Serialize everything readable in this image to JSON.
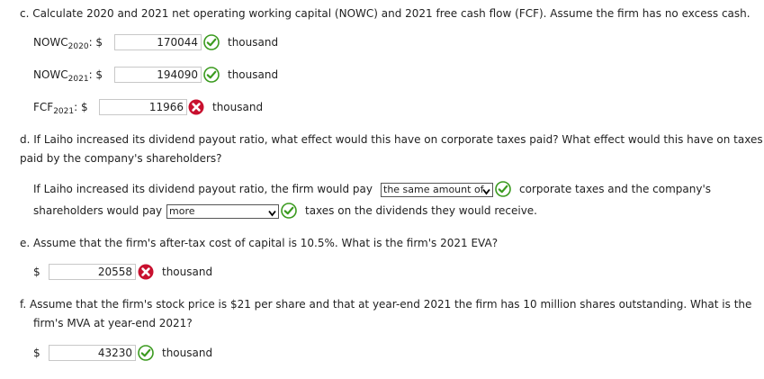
{
  "partC": {
    "question": "c. Calculate 2020 and 2021 net operating working capital (NOWC) and 2021 free cash flow (FCF). Assume the firm has no excess cash.",
    "rows": [
      {
        "label": "NOWC",
        "sub": "2020",
        "suffix": ": $",
        "value": "170044",
        "unit": "thousand",
        "status": "correct"
      },
      {
        "label": "NOWC",
        "sub": "2021",
        "suffix": ": $",
        "value": "194090",
        "unit": "thousand",
        "status": "correct"
      },
      {
        "label": "FCF",
        "sub": "2021",
        "suffix": ": $",
        "value": "11966",
        "unit": "thousand",
        "status": "incorrect"
      }
    ]
  },
  "partD": {
    "question_line1": "d. If Laiho increased its dividend payout ratio, what effect would this have on corporate taxes paid? What effect would this have on taxes",
    "question_line2": "paid by the company's shareholders?",
    "sentence_pre": "If Laiho increased its dividend payout ratio, the firm would pay",
    "select1_value": "the same amount of",
    "sentence_mid": "corporate taxes and the company's",
    "sentence2_pre": "shareholders would pay",
    "select2_value": "more",
    "sentence_post": "taxes on the dividends they would receive."
  },
  "partE": {
    "question": "e. Assume that the firm's after-tax cost of capital is 10.5%. What is the firm's 2021 EVA?",
    "currency": "$",
    "value": "20558",
    "unit": "thousand",
    "status": "incorrect"
  },
  "partF": {
    "question_line1": "f. Assume that the firm's stock price is $21 per share and that at year-end 2021 the firm has 10 million shares outstanding. What is the",
    "question_line2": "firm's MVA at year-end 2021?",
    "currency": "$",
    "value": "43230",
    "unit": "thousand",
    "status": "correct"
  },
  "colors": {
    "correct": "#3a9a1e",
    "incorrect": "#c8102e",
    "input_border": "#c8c8c8"
  },
  "icons": {
    "correct": "check-circle-icon",
    "incorrect": "x-circle-icon"
  }
}
